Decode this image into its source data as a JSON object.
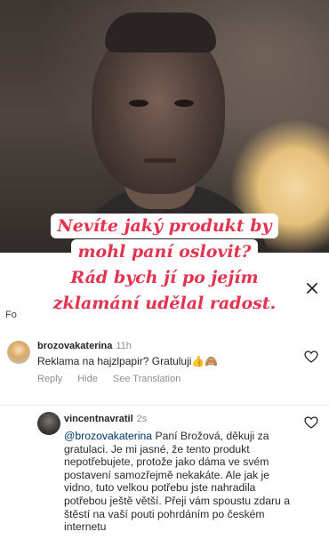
{
  "caption": {
    "lines": [
      "Nevíte jaký produkt by",
      "mohl paní oslovit?",
      "Rád bych  jí  po jejím",
      "zklamání udělal radost."
    ]
  },
  "sheet_header": {
    "partial_label": "Fo"
  },
  "comments": [
    {
      "username": "brozovakaterina",
      "time": "11h",
      "text": "Reklama na hajzlpapir? Gratuluji",
      "emojis": "👍🙈",
      "actions": [
        "Reply",
        "Hide",
        "See Translation"
      ]
    },
    {
      "username": "vincentnavratil",
      "time": "2s",
      "mention": "@brozovakaterina",
      "text": " Paní Brožová, děkuji za gratulaci. Je mi jasné, že tento produkt nepotřebujete, protože jako dáma ve svém postavení samozřejmě nekakáte. Ale jak je vidno, tuto velkou potřebu jste nahradila potřebou ještě větší. Přeji vám spoustu zdaru a štěstí na vaší pouti pohrdáním po českém internetu"
    }
  ],
  "colors": {
    "caption_text": "#e4334e",
    "caption_bg": "#ffffff",
    "username": "#262626",
    "secondary_text": "#8e8e8e",
    "mention": "#00376b"
  },
  "icons": {
    "close": "close-icon",
    "like": "heart-icon"
  }
}
